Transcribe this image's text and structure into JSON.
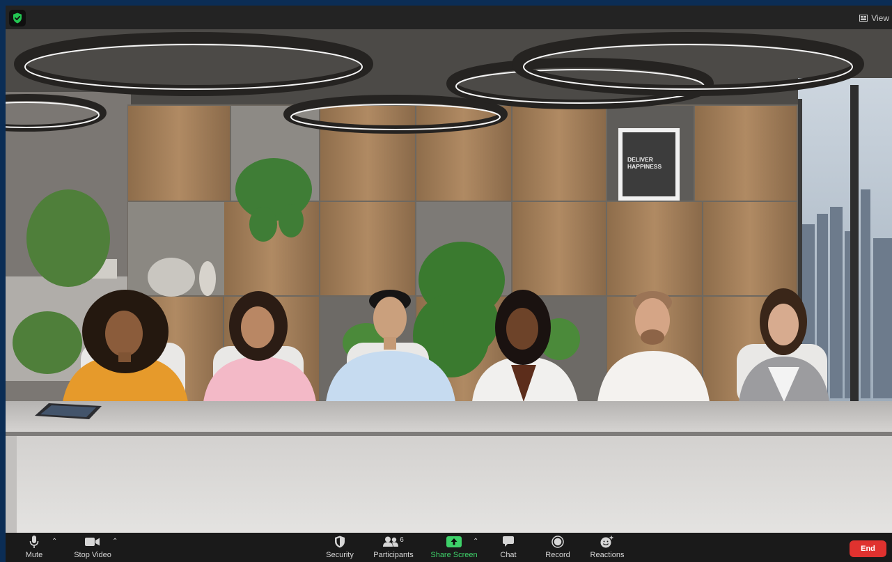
{
  "top_bar": {
    "security_indicator": "shield-check-icon",
    "view_label": "View"
  },
  "scene": {
    "poster_line1": "DELIVER",
    "poster_line2": "HAPPINESS",
    "participants_shown": 6
  },
  "toolbar": {
    "mute_label": "Mute",
    "stop_video_label": "Stop Video",
    "security_label": "Security",
    "participants_label": "Participants",
    "participants_count": "6",
    "share_screen_label": "Share Screen",
    "chat_label": "Chat",
    "record_label": "Record",
    "reactions_label": "Reactions",
    "end_label": "End"
  },
  "colors": {
    "share_accent": "#3ed26a",
    "end_button": "#e0322f",
    "shield_green": "#23c552",
    "toolbar_bg": "#1a1a1a",
    "frame_bg": "#0b2d55"
  }
}
